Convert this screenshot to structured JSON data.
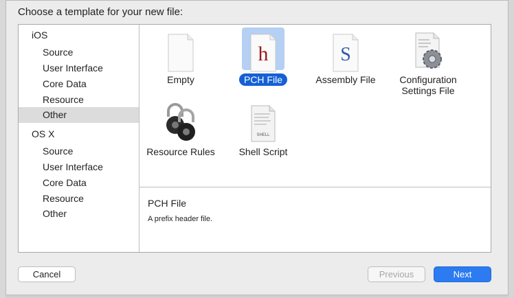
{
  "dialog": {
    "prompt": "Choose a template for your new file:"
  },
  "sidebar": {
    "groups": [
      {
        "label": "iOS",
        "items": [
          "Source",
          "User Interface",
          "Core Data",
          "Resource",
          "Other"
        ]
      },
      {
        "label": "OS X",
        "items": [
          "Source",
          "User Interface",
          "Core Data",
          "Resource",
          "Other"
        ]
      }
    ],
    "selected": "iOS / Other"
  },
  "templates": [
    {
      "label": "Empty",
      "icon": "empty-file-icon"
    },
    {
      "label": "PCH File",
      "icon": "pch-file-icon",
      "glyph": "h",
      "selected": true
    },
    {
      "label": "Assembly File",
      "icon": "assembly-file-icon",
      "glyph": "S"
    },
    {
      "label": "Configuration Settings File",
      "label_line1": "Configuration",
      "label_line2": "Settings File",
      "icon": "configuration-settings-icon"
    },
    {
      "label": "Resource Rules",
      "icon": "resource-rules-lock-icon"
    },
    {
      "label": "Shell Script",
      "icon": "shell-script-icon",
      "glyph": "SHELL"
    }
  ],
  "description": {
    "title": "PCH File",
    "text": "A prefix header file."
  },
  "buttons": {
    "cancel": "Cancel",
    "previous": "Previous",
    "next": "Next"
  },
  "colors": {
    "selection": "#1460d6",
    "selection_bg": "#b5d0f3",
    "primary_button": "#2c7bf0",
    "pch_glyph": "#9b1c1c",
    "assembly_glyph": "#2d5bb0"
  }
}
